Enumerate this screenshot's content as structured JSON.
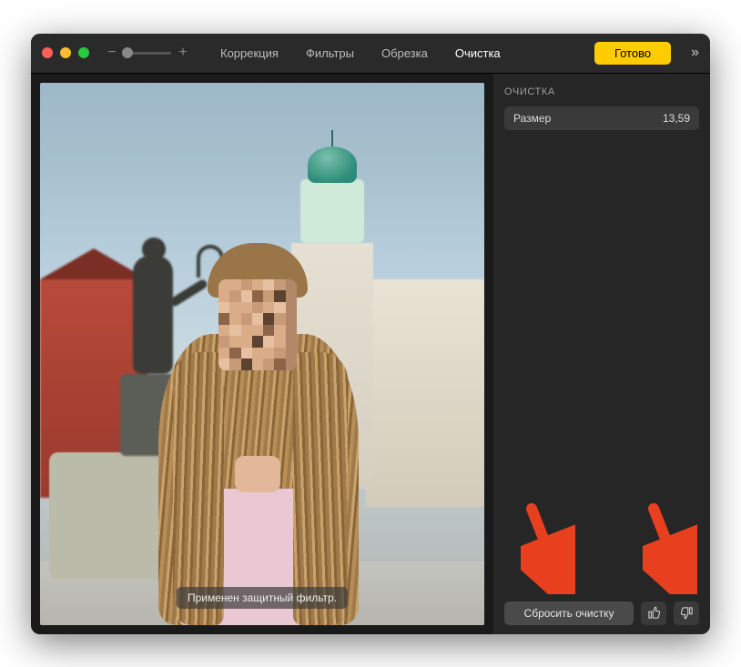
{
  "toolbar": {
    "tabs": {
      "correction": "Коррекция",
      "filters": "Фильтры",
      "crop": "Обрезка",
      "cleanup": "Очистка"
    },
    "done_label": "Готово"
  },
  "sidebar": {
    "title": "ОЧИСТКА",
    "size_label": "Размер",
    "size_value": "13,59",
    "reset_label": "Сбросить очистку"
  },
  "canvas": {
    "overlay_message": "Применен защитный фильтр."
  },
  "icons": {
    "zoom_out": "−",
    "zoom_in": "+",
    "more": "»"
  }
}
